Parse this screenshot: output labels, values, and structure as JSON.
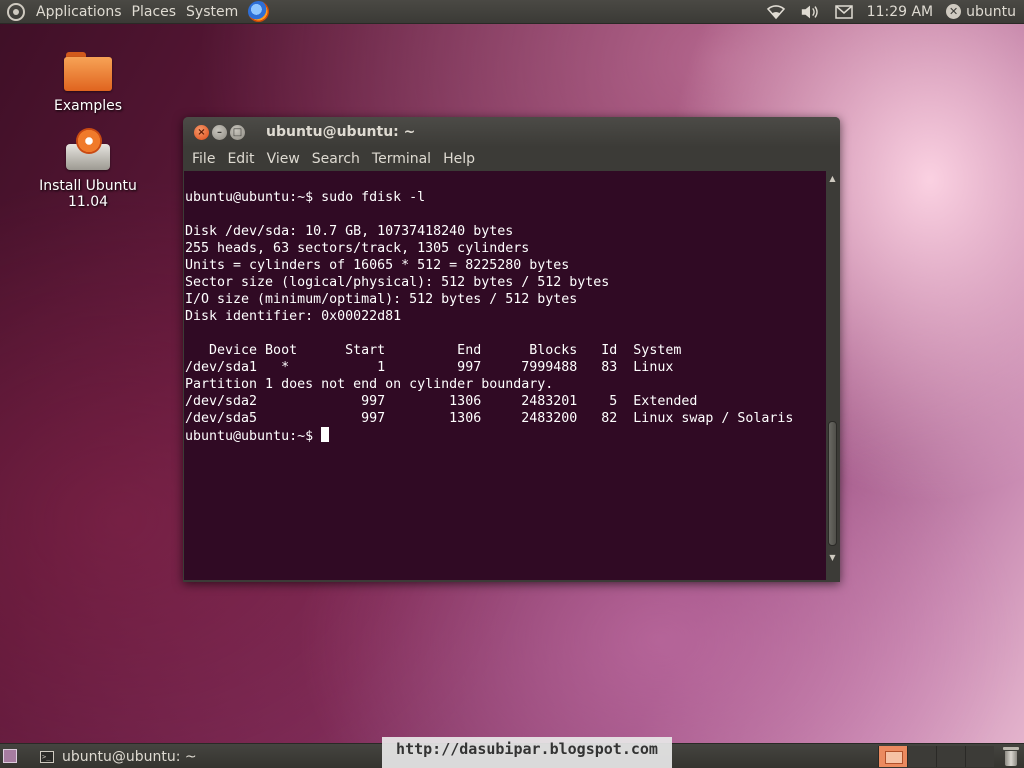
{
  "top_panel": {
    "menus": [
      "Applications",
      "Places",
      "System"
    ],
    "clock": "11:29 AM",
    "user": "ubuntu"
  },
  "desktop": {
    "icons": [
      {
        "label": "Examples",
        "icon": "folder-icon"
      },
      {
        "label": "Install Ubuntu 11.04",
        "icon": "installer-icon"
      }
    ]
  },
  "terminal": {
    "title": "ubuntu@ubuntu: ~",
    "menus": [
      "File",
      "Edit",
      "View",
      "Search",
      "Terminal",
      "Help"
    ],
    "lines": [
      "ubuntu@ubuntu:~$ sudo fdisk -l",
      "",
      "Disk /dev/sda: 10.7 GB, 10737418240 bytes",
      "255 heads, 63 sectors/track, 1305 cylinders",
      "Units = cylinders of 16065 * 512 = 8225280 bytes",
      "Sector size (logical/physical): 512 bytes / 512 bytes",
      "I/O size (minimum/optimal): 512 bytes / 512 bytes",
      "Disk identifier: 0x00022d81",
      "",
      "   Device Boot      Start         End      Blocks   Id  System",
      "/dev/sda1   *           1         997     7999488   83  Linux",
      "Partition 1 does not end on cylinder boundary.",
      "/dev/sda2             997        1306     2483201    5  Extended",
      "/dev/sda5             997        1306     2483200   82  Linux swap / Solaris"
    ],
    "prompt": "ubuntu@ubuntu:~$ "
  },
  "bottom_panel": {
    "task": "ubuntu@ubuntu: ~",
    "watermark": "http://dasubipar.blogspot.com"
  },
  "colors": {
    "terminal_bg": "#300a24",
    "panel_bg": "#3c3b37",
    "close_button": "#df4a16"
  }
}
